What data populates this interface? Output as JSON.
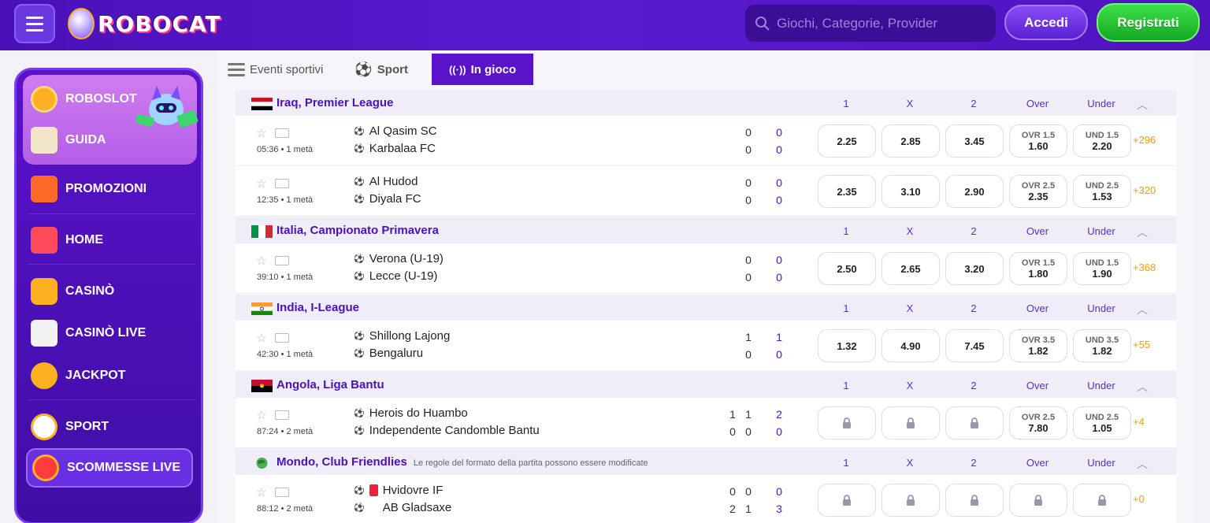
{
  "header": {
    "logo_text": "ROBOCAT",
    "search_placeholder": "Giochi, Categorie, Provider",
    "login_label": "Accedi",
    "register_label": "Registrati"
  },
  "sidebar": {
    "items": [
      {
        "label": "ROBOSLOT",
        "icon": "coin-icon"
      },
      {
        "label": "GUIDA",
        "icon": "map-icon"
      },
      {
        "label": "PROMOZIONI",
        "icon": "gift-icon"
      },
      {
        "label": "HOME",
        "icon": "house-icon"
      },
      {
        "label": "CASINÒ",
        "icon": "slot-icon"
      },
      {
        "label": "CASINÒ LIVE",
        "icon": "cards-icon"
      },
      {
        "label": "JACKPOT",
        "icon": "seven-icon"
      },
      {
        "label": "SPORT",
        "icon": "football-icon"
      },
      {
        "label": "SCOMMESSE LIVE",
        "icon": "live-icon"
      }
    ]
  },
  "tabs": {
    "events_label": "Eventi sportivi",
    "sport_label": "Sport",
    "live_label": "In gioco"
  },
  "columns": {
    "c1": "1",
    "cx": "X",
    "c2": "2",
    "over": "Over",
    "under": "Under"
  },
  "leagues": [
    {
      "name": "Iraq, Premier League",
      "note": "",
      "flag": "iraq",
      "matches": [
        {
          "time": "05:36 • 1 metà",
          "home": "Al Qasim SC",
          "away": "Karbalaa FC",
          "hs": "0",
          "as": "0",
          "ht": "0",
          "at": "0",
          "o1": "2.25",
          "ox": "2.85",
          "o2": "3.45",
          "over_lbl": "OVR 1.5",
          "over": "1.60",
          "under_lbl": "UND 1.5",
          "under": "2.20",
          "more": "+296"
        },
        {
          "time": "12:35 • 1 metà",
          "home": "Al Hudod",
          "away": "Diyala FC",
          "hs": "0",
          "as": "0",
          "ht": "0",
          "at": "0",
          "o1": "2.35",
          "ox": "3.10",
          "o2": "2.90",
          "over_lbl": "OVR 2.5",
          "over": "2.35",
          "under_lbl": "UND 2.5",
          "under": "1.53",
          "more": "+320"
        }
      ]
    },
    {
      "name": "Italia, Campionato Primavera",
      "note": "",
      "flag": "italy",
      "matches": [
        {
          "time": "39:10 • 1 metà",
          "home": "Verona (U-19)",
          "away": "Lecce (U-19)",
          "hs": "0",
          "as": "0",
          "ht": "0",
          "at": "0",
          "o1": "2.50",
          "ox": "2.65",
          "o2": "3.20",
          "over_lbl": "OVR 1.5",
          "over": "1.80",
          "under_lbl": "UND 1.5",
          "under": "1.90",
          "more": "+368"
        }
      ]
    },
    {
      "name": "India, I-League",
      "note": "",
      "flag": "india",
      "matches": [
        {
          "time": "42:30 • 1 metà",
          "home": "Shillong Lajong",
          "away": "Bengaluru",
          "hs": "1",
          "as": "0",
          "ht": "1",
          "at": "0",
          "o1": "1.32",
          "ox": "4.90",
          "o2": "7.45",
          "over_lbl": "OVR 3.5",
          "over": "1.82",
          "under_lbl": "UND 3.5",
          "under": "1.82",
          "more": "+55"
        }
      ]
    },
    {
      "name": "Angola, Liga Bantu",
      "note": "",
      "flag": "angola",
      "matches": [
        {
          "time": "87:24 • 2 metà",
          "home": "Herois do Huambo",
          "away": "Independente Candomble Bantu",
          "h1": "1",
          "a1": "0",
          "hs": "1",
          "as": "0",
          "ht": "2",
          "at": "0",
          "o1": "",
          "ox": "",
          "o2": "",
          "over_lbl": "OVR 2.5",
          "over": "7.80",
          "under_lbl": "UND 2.5",
          "under": "1.05",
          "more": "+4"
        }
      ]
    },
    {
      "name": "Mondo, Club Friendlies",
      "note": "Le regole del formato della partita possono essere modificate",
      "flag": "world",
      "matches": [
        {
          "time": "88:12 • 2 metà",
          "home": "Hvidovre IF",
          "away": "AB Gladsaxe",
          "h1": "0",
          "a1": "2",
          "hs": "0",
          "as": "1",
          "ht": "0",
          "at": "3",
          "o1": "",
          "ox": "",
          "o2": "",
          "over_lbl": "",
          "over": "",
          "under_lbl": "",
          "under": "",
          "more": "+0"
        }
      ]
    }
  ]
}
